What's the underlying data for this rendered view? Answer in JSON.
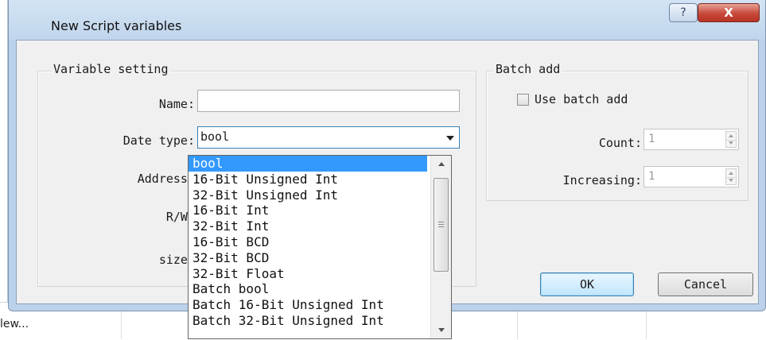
{
  "window": {
    "title": "New Script variables",
    "help_glyph": "?",
    "close_glyph": "X"
  },
  "variable_setting": {
    "legend": "Variable setting",
    "name_label": "Name:",
    "name_value": "",
    "date_type_label": "Date type:",
    "date_type_value": "bool",
    "address_label": "Address:",
    "rw_label": "R/W:",
    "size_label": "size:"
  },
  "batch_add": {
    "legend": "Batch add",
    "use_batch_label": "Use batch add",
    "use_batch_checked": false,
    "count_label": "Count:",
    "count_value": "1",
    "increasing_label": "Increasing:",
    "increasing_value": "1"
  },
  "buttons": {
    "ok": "OK",
    "cancel": "Cancel"
  },
  "dropdown": {
    "items": [
      "bool",
      "16-Bit Unsigned Int",
      "32-Bit Unsigned Int",
      "16-Bit Int",
      "32-Bit Int",
      "16-Bit BCD",
      "32-Bit BCD",
      "32-Bit Float",
      "Batch bool",
      "Batch 16-Bit Unsigned Int",
      "Batch 32-Bit Unsigned Int"
    ],
    "selected_index": 0
  },
  "background": {
    "status_text": "lew..."
  },
  "colors": {
    "window_frame": "#bcd2ea",
    "selection": "#3399ff",
    "close_button": "#c7493a"
  }
}
